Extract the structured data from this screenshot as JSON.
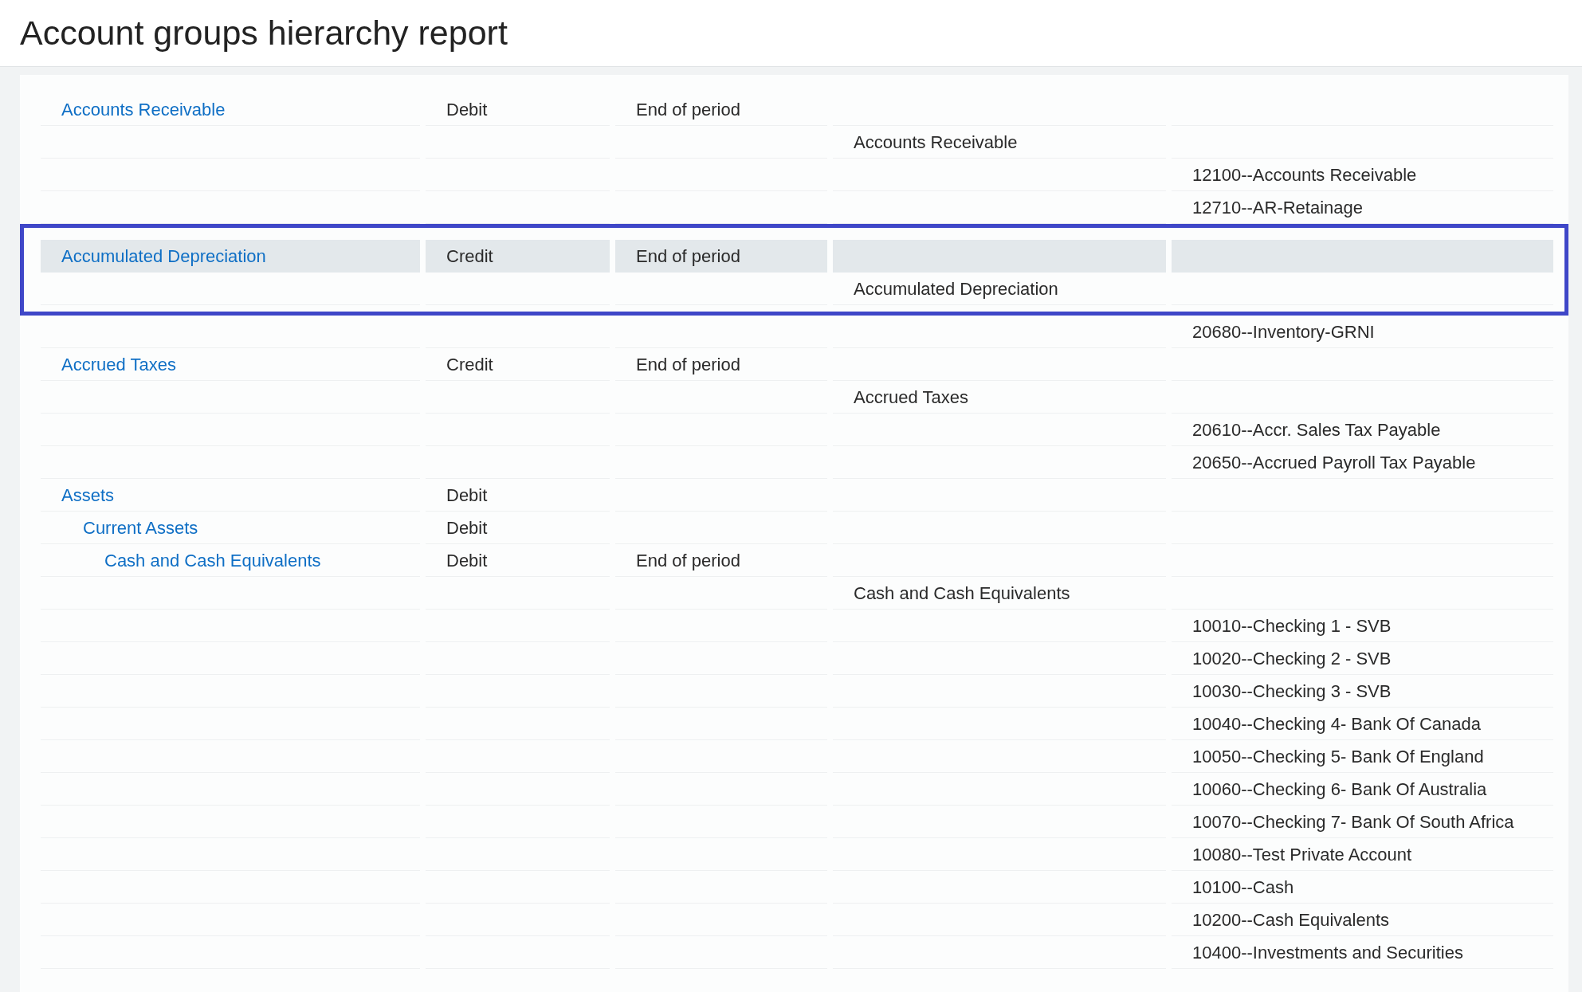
{
  "title": "Account groups hierarchy report",
  "groups": [
    {
      "name": "Accounts Receivable",
      "balance": "Debit",
      "period": "End of period",
      "selected": false,
      "lines": [
        {
          "kind": "member",
          "text": "Accounts Receivable"
        },
        {
          "kind": "account",
          "text": "12100--Accounts Receivable"
        },
        {
          "kind": "account",
          "text": "12710--AR-Retainage"
        }
      ]
    },
    {
      "name": "Accumulated Depreciation",
      "balance": "Credit",
      "period": "End of period",
      "selected": true,
      "lines": [
        {
          "kind": "member",
          "text": "Accumulated Depreciation"
        },
        {
          "kind": "account",
          "text": "20680--Inventory-GRNI"
        }
      ]
    },
    {
      "name": "Accrued Taxes",
      "balance": "Credit",
      "period": "End of period",
      "selected": false,
      "lines": [
        {
          "kind": "member",
          "text": "Accrued Taxes"
        },
        {
          "kind": "account",
          "text": "20610--Accr. Sales Tax Payable"
        },
        {
          "kind": "account",
          "text": "20650--Accrued Payroll Tax Payable"
        }
      ]
    },
    {
      "name": "Assets",
      "balance": "Debit",
      "selected": false,
      "children": [
        {
          "name": "Current Assets",
          "balance": "Debit",
          "selected": false,
          "children": [
            {
              "name": "Cash and Cash Equivalents",
              "balance": "Debit",
              "period": "End of period",
              "selected": false,
              "lines": [
                {
                  "kind": "member",
                  "text": "Cash and Cash Equivalents"
                },
                {
                  "kind": "account",
                  "text": "10010--Checking 1 - SVB"
                },
                {
                  "kind": "account",
                  "text": "10020--Checking 2 - SVB"
                },
                {
                  "kind": "account",
                  "text": "10030--Checking 3 - SVB"
                },
                {
                  "kind": "account",
                  "text": "10040--Checking 4- Bank Of Canada"
                },
                {
                  "kind": "account",
                  "text": "10050--Checking 5- Bank Of England"
                },
                {
                  "kind": "account",
                  "text": "10060--Checking 6- Bank Of Australia"
                },
                {
                  "kind": "account",
                  "text": "10070--Checking 7- Bank Of South Africa"
                },
                {
                  "kind": "account",
                  "text": "10080--Test Private Account"
                },
                {
                  "kind": "account",
                  "text": "10100--Cash"
                },
                {
                  "kind": "account",
                  "text": "10200--Cash Equivalents"
                },
                {
                  "kind": "account",
                  "text": "10400--Investments and Securities"
                }
              ]
            }
          ]
        }
      ]
    }
  ]
}
